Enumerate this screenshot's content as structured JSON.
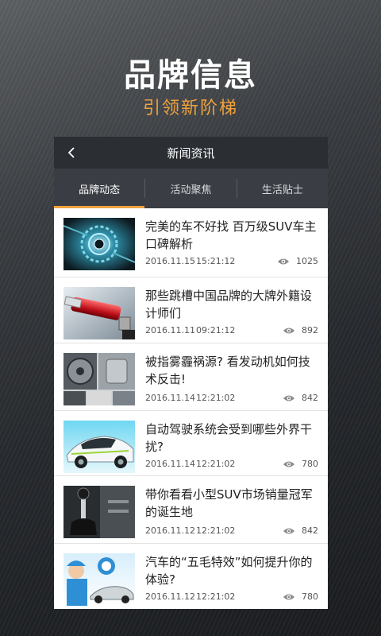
{
  "hero": {
    "title": "品牌信息",
    "subtitle": "引领新阶梯"
  },
  "navbar": {
    "back_icon": "chevron-left-icon",
    "title": "新闻资讯"
  },
  "tabs": [
    {
      "label": "品牌动态",
      "active": true
    },
    {
      "label": "活动聚焦",
      "active": false
    },
    {
      "label": "生活贴士",
      "active": false
    }
  ],
  "colors": {
    "accent": "#f0a23c",
    "navbar": "#2b2e33",
    "tabs_bg": "#3a3e44"
  },
  "news": [
    {
      "title": "完美的车不好找 百万级SUV车主口碑解析",
      "date": "2016.11.15",
      "time": "15:21:12",
      "views": "1025"
    },
    {
      "title": "那些跳槽中国品牌的大牌外籍设计师们",
      "date": "2016.11.11",
      "time": "09:21:12",
      "views": "892"
    },
    {
      "title": "被指雾霾祸源? 看发动机如何技术反击!",
      "date": "2016.11.14",
      "time": "12:21:02",
      "views": "842"
    },
    {
      "title": "自动驾驶系统会受到哪些外界干扰?",
      "date": "2016.11.14",
      "time": "12:21:02",
      "views": "780"
    },
    {
      "title": "带你看看小型SUV市场销量冠军的诞生地",
      "date": "2016.11.12",
      "time": "12:21:02",
      "views": "842"
    },
    {
      "title": "汽车的“五毛特效”如何提升你的体验?",
      "date": "2016.11.12",
      "time": "12:21:02",
      "views": "780"
    }
  ]
}
